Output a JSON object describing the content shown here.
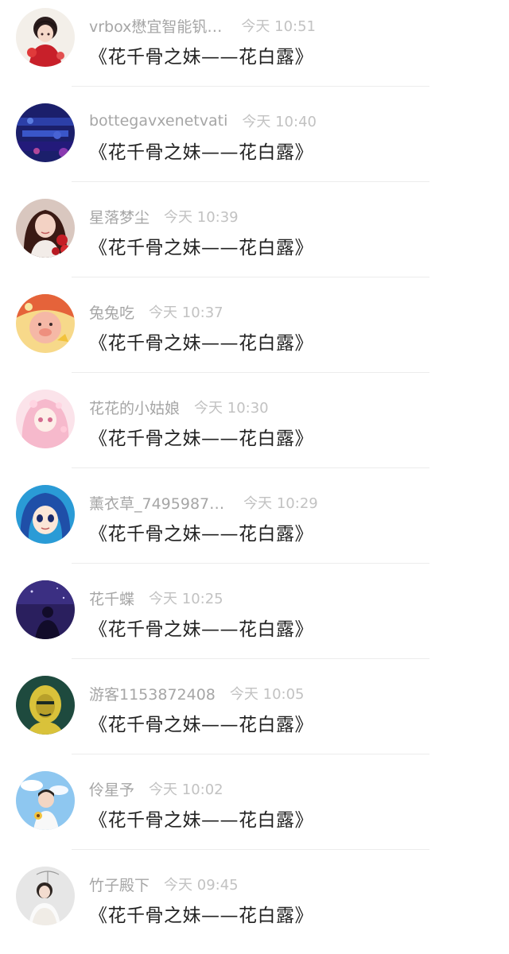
{
  "comments": [
    {
      "name": "vrbox懋宜智能钒…",
      "time": "今天 10:51",
      "text": "《花千骨之妹——花白露》",
      "avatar": "avatar-anime-red"
    },
    {
      "name": "bottegavxenetvati",
      "time": "今天 10:40",
      "text": "《花千骨之妹——花白露》",
      "avatar": "avatar-blue-pattern"
    },
    {
      "name": "星落梦尘",
      "time": "今天 10:39",
      "text": "《花千骨之妹——花白露》",
      "avatar": "avatar-girl-photo"
    },
    {
      "name": "兔兔吃",
      "time": "今天 10:37",
      "text": "《花千骨之妹——花白露》",
      "avatar": "avatar-cartoon-pig"
    },
    {
      "name": "花花的小姑娘",
      "time": "今天 10:30",
      "text": "《花千骨之妹——花白露》",
      "avatar": "avatar-pink-anime"
    },
    {
      "name": "薰衣草_7495987…",
      "time": "今天 10:29",
      "text": "《花千骨之妹——花白露》",
      "avatar": "avatar-blue-anime"
    },
    {
      "name": "花千蝶",
      "time": "今天 10:25",
      "text": "《花千骨之妹——花白露》",
      "avatar": "avatar-night-silhouette"
    },
    {
      "name": "游客1153872408",
      "time": "今天 10:05",
      "text": "《花千骨之妹——花白露》",
      "avatar": "avatar-yellow-portrait"
    },
    {
      "name": "伶星予",
      "time": "今天 10:02",
      "text": "《花千骨之妹——花白露》",
      "avatar": "avatar-sky-boy"
    },
    {
      "name": "竹子殿下",
      "time": "今天 09:45",
      "text": "《花千骨之妹——花白露》",
      "avatar": "avatar-white-girl"
    }
  ],
  "colors": {
    "name": "#a6a6a6",
    "time": "#c2c2c2",
    "message": "#222222",
    "divider": "#ececec"
  }
}
